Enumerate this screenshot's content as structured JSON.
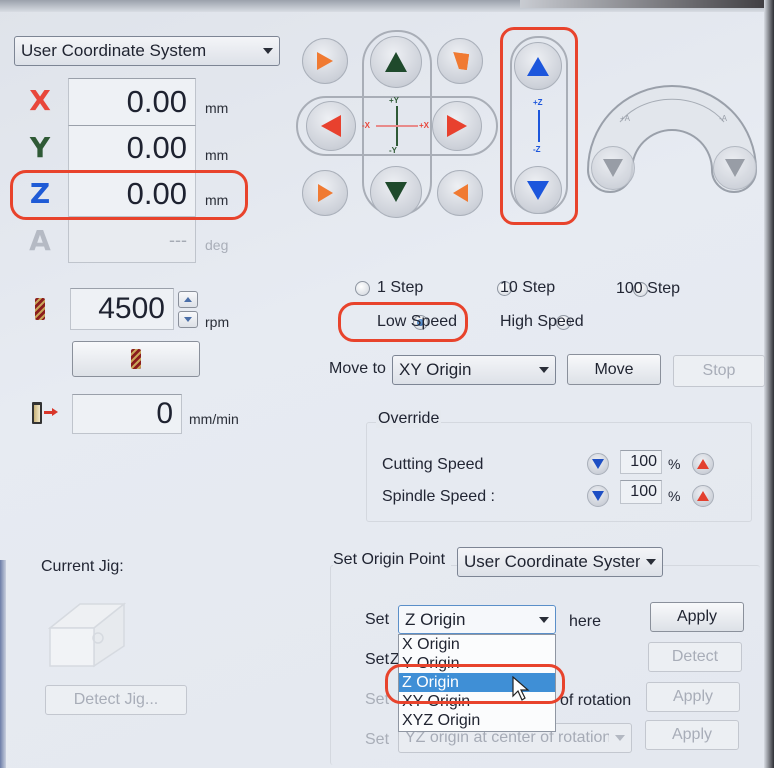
{
  "colors": {
    "x_axis": "#e8463a",
    "y_axis": "#2f5a36",
    "z_axis": "#1f5bd6",
    "a_axis_disabled": "#b5bac4",
    "jog_xy_up_down": "#1f4a2c",
    "jog_x_left_right": "#e8412e",
    "jog_diagonal": "#f07a32",
    "jog_z": "#1c56dc",
    "jog_a_disabled": "#8c919a",
    "override_down": "#1e4fc4",
    "override_up": "#e3402f",
    "highlight_annotation": "#e8432c",
    "dropdown_selection": "#3f8fd6"
  },
  "coordinate_system": {
    "selected": "User Coordinate System"
  },
  "position": [
    {
      "axis": "X",
      "value": "0.00",
      "unit": "mm",
      "enabled": true
    },
    {
      "axis": "Y",
      "value": "0.00",
      "unit": "mm",
      "enabled": true
    },
    {
      "axis": "Z",
      "value": "0.00",
      "unit": "mm",
      "enabled": true
    },
    {
      "axis": "A",
      "value": "---",
      "unit": "deg",
      "enabled": false
    }
  ],
  "jog_pad": {
    "labels": {
      "plus_y": "+Y",
      "minus_y": "-Y",
      "minus_x": "-X",
      "plus_x": "+X"
    },
    "z_labels": {
      "plus_z": "+Z",
      "minus_z": "-Z"
    },
    "a_labels": {
      "plus_a": "+A",
      "minus_a": "-A"
    }
  },
  "spindle": {
    "rpm_value": "4500",
    "rpm_unit": "rpm",
    "feed_value": "0",
    "feed_unit": "mm/min"
  },
  "step_mode": {
    "options": [
      {
        "label": "1 Step",
        "checked": false
      },
      {
        "label": "10 Step",
        "checked": false
      },
      {
        "label": "100 Step",
        "checked": false
      },
      {
        "label": "Low Speed",
        "checked": true
      },
      {
        "label": "High Speed",
        "checked": false
      }
    ]
  },
  "move_to": {
    "label": "Move to",
    "selected": "XY Origin",
    "move_button": "Move",
    "stop_button": "Stop"
  },
  "override": {
    "title": "Override",
    "rows": [
      {
        "label": "Cutting Speed",
        "value": "100",
        "unit": "%"
      },
      {
        "label": "Spindle Speed :",
        "value": "100",
        "unit": "%"
      }
    ]
  },
  "jig": {
    "label": "Current Jig:",
    "detect_button": "Detect Jig..."
  },
  "set_origin": {
    "label": "Set Origin Point",
    "system": "User Coordinate System",
    "rows": [
      {
        "radio_label": "Set",
        "combo_value": "Z Origin",
        "suffix": "here",
        "button": "Apply",
        "checked": true,
        "enabled": true
      },
      {
        "radio_label": "Set",
        "combo_value": "Z",
        "suffix": "",
        "button": "Detect",
        "checked": false,
        "enabled": true
      },
      {
        "radio_label": "Set",
        "combo_value": "",
        "suffix": "of rotation",
        "button": "Apply",
        "checked": false,
        "enabled": false
      },
      {
        "radio_label": "Set",
        "combo_value": "YZ origin at center of rotation",
        "suffix": "",
        "button": "Apply",
        "checked": false,
        "enabled": false
      }
    ],
    "dropdown_options": [
      "X Origin",
      "Y Origin",
      "Z Origin",
      "XY Origin",
      "XYZ Origin"
    ],
    "dropdown_selected": "Z Origin"
  }
}
